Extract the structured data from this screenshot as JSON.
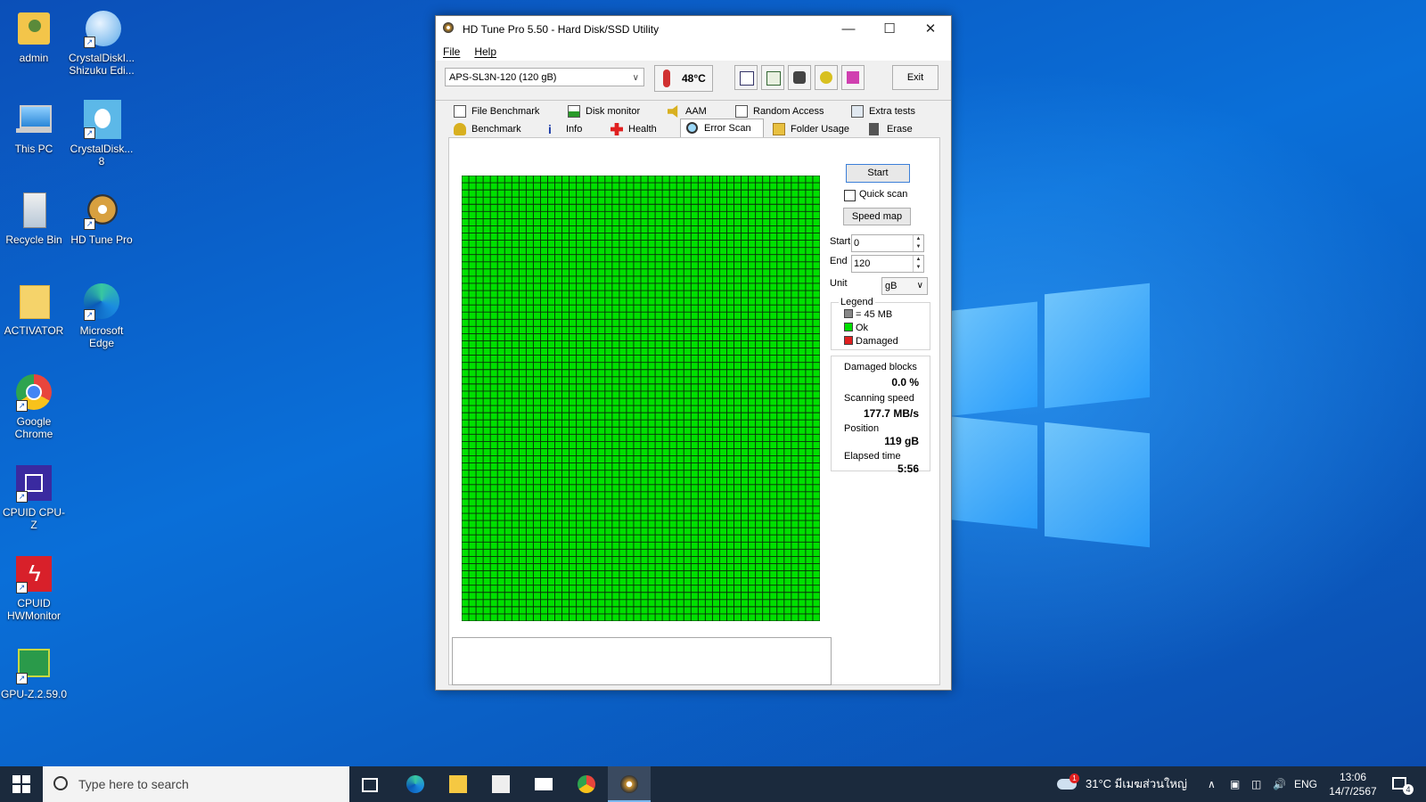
{
  "desktop_icons": [
    {
      "label": "admin"
    },
    {
      "label": "CrystalDiskI... Shizuku Edi..."
    },
    {
      "label": "This PC"
    },
    {
      "label": "CrystalDisk... 8"
    },
    {
      "label": "Recycle Bin"
    },
    {
      "label": "HD Tune Pro"
    },
    {
      "label": "ACTIVATOR"
    },
    {
      "label": "Microsoft Edge"
    },
    {
      "label": "Google Chrome"
    },
    {
      "label": "CPUID CPU-Z"
    },
    {
      "label": "CPUID HWMonitor"
    },
    {
      "label": "GPU-Z.2.59.0"
    }
  ],
  "window": {
    "title": "HD Tune Pro 5.50 - Hard Disk/SSD Utility",
    "menu": [
      "File",
      "Help"
    ],
    "drive": "APS-SL3N-120 (120 gB)",
    "temperature": "48°C",
    "exit_label": "Exit",
    "tabs_row1": [
      "File Benchmark",
      "Disk monitor",
      "AAM",
      "Random Access",
      "Extra tests"
    ],
    "tabs_row2": [
      "Benchmark",
      "Info",
      "Health",
      "Error Scan",
      "Folder Usage",
      "Erase"
    ],
    "active_tab": "Error Scan"
  },
  "error_scan": {
    "start_button": "Start",
    "quick_scan_label": "Quick scan",
    "quick_scan_checked": false,
    "speed_map_button": "Speed map",
    "start_label": "Start",
    "start_value": "0",
    "end_label": "End",
    "end_value": "120",
    "unit_label": "Unit",
    "unit_value": "gB",
    "legend_title": "Legend",
    "legend_block": "= 45 MB",
    "legend_ok": "Ok",
    "legend_damaged": "Damaged",
    "damaged_blocks_label": "Damaged blocks",
    "damaged_blocks_value": "0.0 %",
    "scanning_speed_label": "Scanning speed",
    "scanning_speed_value": "177.7 MB/s",
    "position_label": "Position",
    "position_value": "119 gB",
    "elapsed_time_label": "Elapsed time",
    "elapsed_time_value": "5:56",
    "map_block_color": "#00e000",
    "map_grid_color": "#0a2a0a",
    "damaged_color": "#e02020",
    "map_cols": 50,
    "map_rows": 62
  },
  "taskbar": {
    "search_placeholder": "Type here to search",
    "weather": "31°C มีเมฆส่วนใหญ่",
    "weather_badge": "1",
    "language": "ENG",
    "time": "13:06",
    "date": "14/7/2567",
    "notification_count": "4"
  },
  "colors": {
    "accent": "#0078d7",
    "taskbar": "#1b2a3d"
  }
}
